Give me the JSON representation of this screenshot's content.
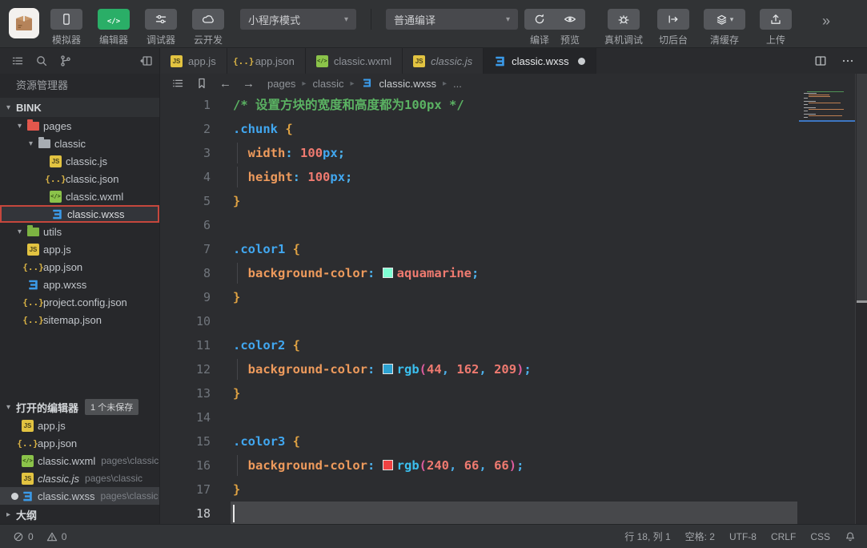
{
  "toolbar": {
    "nav_buttons": [
      {
        "label": "模拟器",
        "icon": "phone-icon",
        "active": false
      },
      {
        "label": "编辑器",
        "icon": "code-icon",
        "active": true
      },
      {
        "label": "调试器",
        "icon": "sliders-icon",
        "active": false
      },
      {
        "label": "云开发",
        "icon": "cloud-icon",
        "active": false
      }
    ],
    "mode_dropdown": "小程序模式",
    "compile_dropdown": "普通编译",
    "action_pair": [
      {
        "label": "编译",
        "icon": "refresh-icon"
      },
      {
        "label": "预览",
        "icon": "eye-icon"
      }
    ],
    "actions": [
      {
        "label": "真机调试",
        "icon": "bug-icon"
      },
      {
        "label": "切后台",
        "icon": "switch-background-icon"
      },
      {
        "label": "清缓存",
        "icon": "layers-icon",
        "caret": true
      },
      {
        "label": "上传",
        "icon": "upload-icon"
      }
    ],
    "overflow": "»"
  },
  "sidebar": {
    "title": "资源管理器",
    "root": "BINK",
    "tree": [
      {
        "label": "pages",
        "icon": "folder-pages",
        "level": 1,
        "folder": true
      },
      {
        "label": "classic",
        "icon": "folder-grey",
        "level": 2,
        "folder": true
      },
      {
        "label": "classic.js",
        "icon": "js",
        "level": 3
      },
      {
        "label": "classic.json",
        "icon": "json",
        "level": 3
      },
      {
        "label": "classic.wxml",
        "icon": "wxml",
        "level": 3
      },
      {
        "label": "classic.wxss",
        "icon": "wxss",
        "level": 3,
        "selected": true
      },
      {
        "label": "utils",
        "icon": "folder-green",
        "level": 1,
        "folder": true
      },
      {
        "label": "app.js",
        "icon": "js",
        "level": 1
      },
      {
        "label": "app.json",
        "icon": "json",
        "level": 1
      },
      {
        "label": "app.wxss",
        "icon": "wxss",
        "level": 1
      },
      {
        "label": "project.config.json",
        "icon": "json",
        "level": 1
      },
      {
        "label": "sitemap.json",
        "icon": "json",
        "level": 1
      }
    ],
    "open_editors": {
      "title": "打开的编辑器",
      "badge": "1 个未保存",
      "items": [
        {
          "label": "app.js",
          "icon": "js"
        },
        {
          "label": "app.json",
          "icon": "json"
        },
        {
          "label": "classic.wxml",
          "icon": "wxml",
          "path": "pages\\classic"
        },
        {
          "label": "classic.js",
          "icon": "js",
          "path": "pages\\classic",
          "italic": true
        },
        {
          "label": "classic.wxss",
          "icon": "wxss",
          "path": "pages\\classic",
          "dirty": true,
          "selected": true
        }
      ]
    },
    "outline_label": "大纲"
  },
  "tabs": [
    {
      "label": "app.js",
      "icon": "js"
    },
    {
      "label": "app.json",
      "icon": "json"
    },
    {
      "label": "classic.wxml",
      "icon": "wxml"
    },
    {
      "label": "classic.js",
      "icon": "js",
      "italic": true
    },
    {
      "label": "classic.wxss",
      "icon": "wxss",
      "active": true,
      "dirty": true
    }
  ],
  "breadcrumb": {
    "items": [
      "pages",
      "classic",
      "classic.wxss",
      "..."
    ]
  },
  "editor": {
    "lines": [
      {
        "n": 1,
        "tokens": [
          [
            "cm",
            "/* 设置方块的宽度和高度都为100px */"
          ]
        ]
      },
      {
        "n": 2,
        "tokens": [
          [
            "sel",
            ".chunk"
          ],
          [
            "pl",
            " "
          ],
          [
            "br",
            "{"
          ]
        ]
      },
      {
        "n": 3,
        "guide": true,
        "tokens": [
          [
            "pl",
            "  "
          ],
          [
            "prop",
            "width"
          ],
          [
            "pun",
            ":"
          ],
          [
            "pl",
            " "
          ],
          [
            "num",
            "100"
          ],
          [
            "unit",
            "px"
          ],
          [
            "pun",
            ";"
          ]
        ]
      },
      {
        "n": 4,
        "guide": true,
        "tokens": [
          [
            "pl",
            "  "
          ],
          [
            "prop",
            "height"
          ],
          [
            "pun",
            ":"
          ],
          [
            "pl",
            " "
          ],
          [
            "num",
            "100"
          ],
          [
            "unit",
            "px"
          ],
          [
            "pun",
            ";"
          ]
        ]
      },
      {
        "n": 5,
        "tokens": [
          [
            "br",
            "}"
          ]
        ]
      },
      {
        "n": 6,
        "tokens": []
      },
      {
        "n": 7,
        "tokens": [
          [
            "sel",
            ".color1"
          ],
          [
            "pl",
            " "
          ],
          [
            "br",
            "{"
          ]
        ]
      },
      {
        "n": 8,
        "guide": true,
        "tokens": [
          [
            "pl",
            "  "
          ],
          [
            "prop",
            "background-color"
          ],
          [
            "pun",
            ":"
          ],
          [
            "pl",
            " "
          ],
          [
            "swatch",
            "#7fffd4"
          ],
          [
            "val",
            "aquamarine"
          ],
          [
            "pun",
            ";"
          ]
        ]
      },
      {
        "n": 9,
        "tokens": [
          [
            "br",
            "}"
          ]
        ]
      },
      {
        "n": 10,
        "tokens": []
      },
      {
        "n": 11,
        "tokens": [
          [
            "sel",
            ".color2"
          ],
          [
            "pl",
            " "
          ],
          [
            "br",
            "{"
          ]
        ]
      },
      {
        "n": 12,
        "guide": true,
        "tokens": [
          [
            "pl",
            "  "
          ],
          [
            "prop",
            "background-color"
          ],
          [
            "pun",
            ":"
          ],
          [
            "pl",
            " "
          ],
          [
            "swatch",
            "#2ca2d1"
          ],
          [
            "fn",
            "rgb"
          ],
          [
            "paren",
            "("
          ],
          [
            "num",
            "44"
          ],
          [
            "pun",
            ","
          ],
          [
            "pl",
            " "
          ],
          [
            "num",
            "162"
          ],
          [
            "pun",
            ","
          ],
          [
            "pl",
            " "
          ],
          [
            "num",
            "209"
          ],
          [
            "paren",
            ")"
          ],
          [
            "pun",
            ";"
          ]
        ]
      },
      {
        "n": 13,
        "tokens": [
          [
            "br",
            "}"
          ]
        ]
      },
      {
        "n": 14,
        "tokens": []
      },
      {
        "n": 15,
        "tokens": [
          [
            "sel",
            ".color3"
          ],
          [
            "pl",
            " "
          ],
          [
            "br",
            "{"
          ]
        ]
      },
      {
        "n": 16,
        "guide": true,
        "tokens": [
          [
            "pl",
            "  "
          ],
          [
            "prop",
            "background-color"
          ],
          [
            "pun",
            ":"
          ],
          [
            "pl",
            " "
          ],
          [
            "swatch",
            "#f04242"
          ],
          [
            "fn",
            "rgb"
          ],
          [
            "paren",
            "("
          ],
          [
            "num",
            "240"
          ],
          [
            "pun",
            ","
          ],
          [
            "pl",
            " "
          ],
          [
            "num",
            "66"
          ],
          [
            "pun",
            ","
          ],
          [
            "pl",
            " "
          ],
          [
            "num",
            "66"
          ],
          [
            "paren",
            ")"
          ],
          [
            "pun",
            ";"
          ]
        ]
      },
      {
        "n": 17,
        "tokens": [
          [
            "br",
            "}"
          ]
        ]
      },
      {
        "n": 18,
        "current": true,
        "cursor": true,
        "tokens": []
      }
    ]
  },
  "status_bar": {
    "errors": "0",
    "warnings": "0",
    "cursor": "行 18, 列 1",
    "indent": "空格: 2",
    "encoding": "UTF-8",
    "eol": "CRLF",
    "language": "CSS"
  },
  "colors": {
    "accent_green": "#2aae67",
    "selection_red": "#c5473d",
    "swatch_aquamarine": "#7fffd4",
    "swatch_blue": "#2ca2d1",
    "swatch_red": "#f04242"
  }
}
